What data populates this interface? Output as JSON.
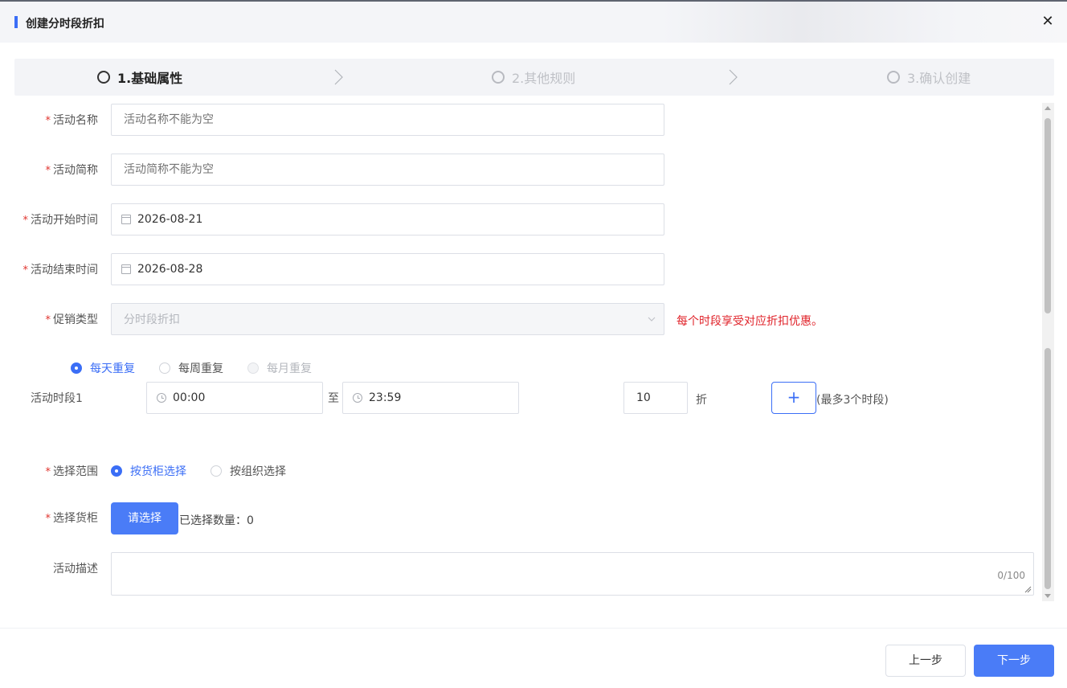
{
  "dialog": {
    "title": "创建分时段折扣",
    "close_glyph": "✕"
  },
  "steps": [
    {
      "label": "1.基础属性",
      "active": true
    },
    {
      "label": "2.其他规则",
      "active": false
    },
    {
      "label": "3.确认创建",
      "active": false
    }
  ],
  "form": {
    "activity_name": {
      "label": "活动名称",
      "placeholder": "活动名称不能为空",
      "value": ""
    },
    "activity_short": {
      "label": "活动简称",
      "placeholder": "活动简称不能为空",
      "value": ""
    },
    "start_time": {
      "label": "活动开始时间",
      "value": "2026-08-21"
    },
    "end_time": {
      "label": "活动结束时间",
      "value": "2026-08-28"
    },
    "promo_type": {
      "label": "促销类型",
      "value": "分时段折扣",
      "hint": "每个时段享受对应折扣优惠。"
    },
    "repeat": {
      "options": [
        "每天重复",
        "每周重复",
        "每月重复"
      ],
      "selected": "每天重复",
      "disabled": [
        "每月重复"
      ]
    },
    "period": {
      "label": "活动时段1",
      "from": "00:00",
      "to_sep": "至",
      "to": "23:59",
      "discount": "10",
      "discount_unit": "折",
      "add_glyph": "+",
      "max_hint": "(最多3个时段)"
    },
    "scope": {
      "label": "选择范围",
      "options": [
        "按货柜选择",
        "按组织选择"
      ],
      "selected": "按货柜选择"
    },
    "cabinet": {
      "label": "选择货柜",
      "button": "请选择",
      "selected_count_text": "已选择数量：0"
    },
    "description": {
      "label": "活动描述",
      "value": "",
      "counter": "0/100"
    }
  },
  "footer": {
    "prev": "上一步",
    "next": "下一步"
  },
  "colors": {
    "primary": "#3b6ef6",
    "required": "#e0332e",
    "hint": "#e0232a"
  }
}
